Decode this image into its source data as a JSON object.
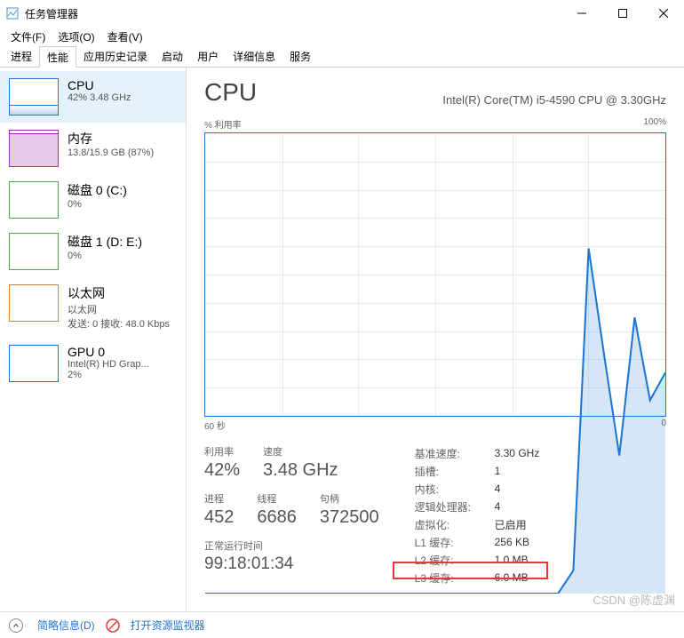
{
  "window": {
    "title": "任务管理器"
  },
  "menu": {
    "file": "文件(F)",
    "options": "选项(O)",
    "view": "查看(V)"
  },
  "tabs": [
    {
      "label": "进程"
    },
    {
      "label": "性能"
    },
    {
      "label": "应用历史记录"
    },
    {
      "label": "启动"
    },
    {
      "label": "用户"
    },
    {
      "label": "详细信息"
    },
    {
      "label": "服务"
    }
  ],
  "sidebar": {
    "items": [
      {
        "title": "CPU",
        "value": "42% 3.48 GHz"
      },
      {
        "title": "内存",
        "value": "13.8/15.9 GB (87%)"
      },
      {
        "title": "磁盘 0 (C:)",
        "value": "0%"
      },
      {
        "title": "磁盘 1 (D: E:)",
        "value": "0%"
      },
      {
        "title": "以太网",
        "value": "以太网",
        "value2": "发送: 0 接收: 48.0 Kbps"
      },
      {
        "title": "GPU 0",
        "value": "Intel(R) HD Grap...",
        "value2": "2%"
      }
    ]
  },
  "detail": {
    "title": "CPU",
    "subtitle": "Intel(R) Core(TM) i5-4590 CPU @ 3.30GHz",
    "graph_ylabel": "% 利用率",
    "graph_ymax": "100%",
    "graph_xleft": "60 秒",
    "graph_xright": "0",
    "stats": {
      "utilization": {
        "label": "利用率",
        "value": "42%"
      },
      "speed": {
        "label": "速度",
        "value": "3.48 GHz"
      },
      "processes": {
        "label": "进程",
        "value": "452"
      },
      "threads": {
        "label": "线程",
        "value": "6686"
      },
      "handles": {
        "label": "句柄",
        "value": "372500"
      },
      "uptime": {
        "label": "正常运行时间",
        "value": "99:18:01:34"
      }
    },
    "specs": [
      {
        "key": "基准速度:",
        "val": "3.30 GHz"
      },
      {
        "key": "插槽:",
        "val": "1"
      },
      {
        "key": "内核:",
        "val": "4"
      },
      {
        "key": "逻辑处理器:",
        "val": "4"
      },
      {
        "key": "虚拟化:",
        "val": "已启用"
      },
      {
        "key": "L1 缓存:",
        "val": "256 KB"
      },
      {
        "key": "L2 缓存:",
        "val": "1.0 MB"
      },
      {
        "key": "L3 缓存:",
        "val": "6.0 MB"
      }
    ]
  },
  "statusbar": {
    "lessDetails": "简略信息(D)",
    "openResMon": "打开资源监视器"
  },
  "watermark": "CSDN @陈虚渊",
  "chart_data": {
    "type": "line",
    "title": "% 利用率",
    "xlabel": "秒",
    "ylabel": "% 利用率",
    "ylim": [
      0,
      100
    ],
    "xlim_seconds": [
      60,
      0
    ],
    "x": [
      60,
      58,
      56,
      54,
      52,
      50,
      48,
      46,
      44,
      42,
      40,
      38,
      36,
      34,
      32,
      30,
      28,
      26,
      24,
      22,
      20,
      18,
      16,
      14,
      12,
      10,
      8,
      6,
      4,
      2,
      0
    ],
    "values": [
      0,
      0,
      0,
      0,
      0,
      0,
      0,
      0,
      0,
      0,
      0,
      0,
      0,
      0,
      0,
      0,
      0,
      0,
      0,
      0,
      0,
      0,
      0,
      0,
      5,
      75,
      52,
      30,
      60,
      42,
      48
    ]
  }
}
